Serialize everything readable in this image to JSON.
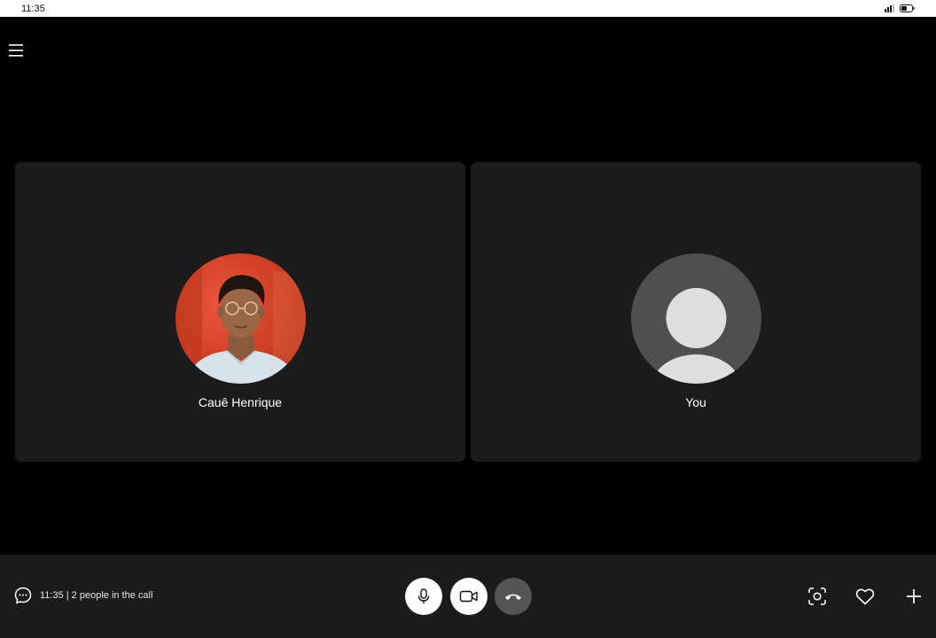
{
  "status_bar": {
    "time": "11:35",
    "icons": [
      "signal-icon",
      "battery-icon"
    ]
  },
  "header": {
    "menu_icon": "hamburger-menu-icon"
  },
  "participants": [
    {
      "name": "Cauê Henrique",
      "avatar": "photo",
      "accent": "#d6452a"
    },
    {
      "name": "You",
      "avatar": "default-person-icon",
      "accent": "#4f4f4f"
    }
  ],
  "control_bar": {
    "call_info": "11:35 | 2 people in the call",
    "chat_icon": "chat-icon",
    "buttons": [
      {
        "icon": "microphone-icon"
      },
      {
        "icon": "video-camera-icon"
      },
      {
        "icon": "end-call-icon"
      }
    ],
    "right_actions": [
      {
        "icon": "screen-share-icon"
      },
      {
        "icon": "heart-icon"
      },
      {
        "icon": "plus-icon"
      }
    ]
  },
  "colors": {
    "background": "#000000",
    "tile": "#1b1b1b",
    "control_bar": "#1b1b1b",
    "end_call": "#555555"
  }
}
